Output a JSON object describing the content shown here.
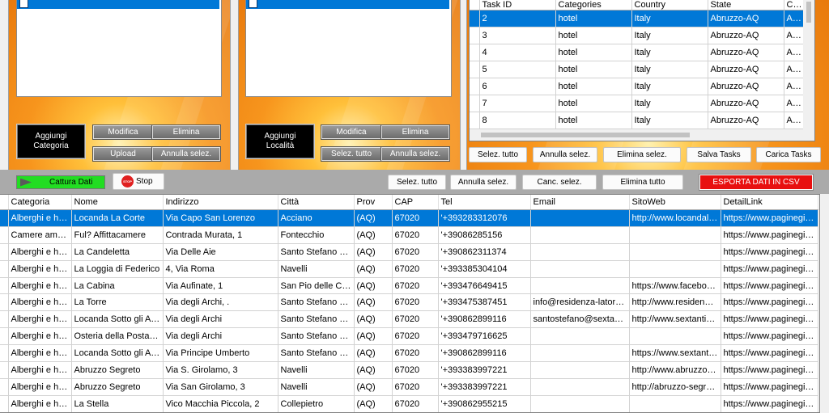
{
  "left_panel_1": {
    "add_button": "Aggiungi Categoria",
    "modify": "Modifica",
    "delete": "Elimina",
    "upload": "Upload",
    "cancel_selection": "Annulla selez."
  },
  "left_panel_2": {
    "add_button": "Aggiungi Località",
    "modify": "Modifica",
    "delete": "Elimina",
    "select_all": "Selez. tutto",
    "cancel_selection": "Annulla selez."
  },
  "tasks": {
    "columns": [
      "Task ID",
      "Categories",
      "Country",
      "State",
      "City"
    ],
    "rows": [
      {
        "id": "2",
        "category": "hotel",
        "country": "Italy",
        "state": "Abruzzo-AQ",
        "city": "Aielli"
      },
      {
        "id": "3",
        "category": "hotel",
        "country": "Italy",
        "state": "Abruzzo-AQ",
        "city": "Albe"
      },
      {
        "id": "4",
        "category": "hotel",
        "country": "Italy",
        "state": "Abruzzo-AQ",
        "city": "Alfe"
      },
      {
        "id": "5",
        "category": "hotel",
        "country": "Italy",
        "state": "Abruzzo-AQ",
        "city": "Antr"
      },
      {
        "id": "6",
        "category": "hotel",
        "country": "Italy",
        "state": "Abruzzo-AQ",
        "city": "Anve"
      },
      {
        "id": "7",
        "category": "hotel",
        "country": "Italy",
        "state": "Abruzzo-AQ",
        "city": "Arag"
      },
      {
        "id": "8",
        "category": "hotel",
        "country": "Italy",
        "state": "Abruzzo-AQ",
        "city": "Aring"
      }
    ],
    "buttons": {
      "select_all": "Selez. tutto",
      "cancel_selection": "Annulla selez.",
      "delete_selected": "Elimina selez.",
      "save_tasks": "Salva Tasks",
      "load_tasks": "Carica Tasks"
    }
  },
  "toolbar": {
    "capture": "Cattura Dati",
    "stop_icon_text": "STOP",
    "stop": "Stop",
    "select_all": "Selez. tutto",
    "cancel_selection": "Annulla selez.",
    "clear_selection": "Canc. selez.",
    "delete_all": "Elimina tutto",
    "export_csv": "ESPORTA DATI IN CSV"
  },
  "results": {
    "columns": [
      "Categoria",
      "Nome",
      "Indirizzo",
      "Città",
      "Prov",
      "CAP",
      "Tel",
      "Email",
      "SitoWeb",
      "DetailLink"
    ],
    "rows": [
      {
        "categoria": "Alberghi e hotel",
        "nome": "Locanda La Corte",
        "indirizzo": "Via Capo San Lorenzo",
        "citta": "Acciano",
        "prov": "(AQ)",
        "cap": "67020",
        "tel": "'+393283312076",
        "email": "",
        "sito": "http://www.locandalacorte.it",
        "link": "https://www.paginegialle.it"
      },
      {
        "categoria": "Camere ammobiliate",
        "nome": "Ful? Affittacamere",
        "indirizzo": "Contrada Murata, 1",
        "citta": "Fontecchio",
        "prov": "(AQ)",
        "cap": "67020",
        "tel": "'+39086285156",
        "email": "",
        "sito": "",
        "link": "https://www.paginegialle.it"
      },
      {
        "categoria": "Alberghi e hotel",
        "nome": "La Candeletta",
        "indirizzo": "Via Delle Aie",
        "citta": "Santo Stefano Di Sessanio",
        "prov": "(AQ)",
        "cap": "67020",
        "tel": "'+390862311374",
        "email": "",
        "sito": "",
        "link": "https://www.paginegialle.it"
      },
      {
        "categoria": "Alberghi e hotel",
        "nome": "La Loggia di Federico",
        "indirizzo": "4, Via Roma",
        "citta": "Navelli",
        "prov": "(AQ)",
        "cap": "67020",
        "tel": "'+393385304104",
        "email": "",
        "sito": "",
        "link": "https://www.paginegialle.it"
      },
      {
        "categoria": "Alberghi e hotel",
        "nome": "La Cabina",
        "indirizzo": "Via Aufinate, 1",
        "citta": "San Pio delle Camere",
        "prov": "(AQ)",
        "cap": "67020",
        "tel": "'+393476649415",
        "email": "",
        "sito": "https://www.facebook.com",
        "link": "https://www.paginegialle.it"
      },
      {
        "categoria": "Alberghi e hotel",
        "nome": "La Torre",
        "indirizzo": "Via degli Archi, .",
        "citta": "Santo Stefano di Sessanio",
        "prov": "(AQ)",
        "cap": "67020",
        "tel": "'+393475387451",
        "email": "info@residenza-latorre.it",
        "sito": "http://www.residenza-latorre.it",
        "link": "https://www.paginegialle.it"
      },
      {
        "categoria": "Alberghi e hotel",
        "nome": "Locanda Sotto gli Archi",
        "indirizzo": "Via degli Archi",
        "citta": "Santo Stefano di Sessanio",
        "prov": "(AQ)",
        "cap": "67020",
        "tel": "'+390862899116",
        "email": "santostefano@sextantio.it",
        "sito": "http://www.sextantio.it",
        "link": "https://www.paginegialle.it"
      },
      {
        "categoria": "Alberghi e hotel",
        "nome": "Osteria della Posta di Sextantio",
        "indirizzo": "Via degli Archi",
        "citta": "Santo Stefano di Sessanio",
        "prov": "(AQ)",
        "cap": "67020",
        "tel": "'+393479716625",
        "email": "",
        "sito": "",
        "link": "https://www.paginegialle.it"
      },
      {
        "categoria": "Alberghi e hotel",
        "nome": "Locanda Sotto gli Archi",
        "indirizzo": "Via Principe Umberto",
        "citta": "Santo Stefano di Sessanio",
        "prov": "(AQ)",
        "cap": "67020",
        "tel": "'+390862899116",
        "email": "",
        "sito": "https://www.sextantio.it",
        "link": "https://www.paginegialle.it"
      },
      {
        "categoria": "Alberghi e hotel",
        "nome": "Abruzzo Segreto",
        "indirizzo": "Via S. Girolamo, 3",
        "citta": "Navelli",
        "prov": "(AQ)",
        "cap": "67020",
        "tel": "'+393383997221",
        "email": "",
        "sito": "http://www.abruzzo-segreto.it",
        "link": "https://www.paginegialle.it"
      },
      {
        "categoria": "Alberghi e hotel",
        "nome": "Abruzzo Segreto",
        "indirizzo": "Via San Girolamo, 3",
        "citta": "Navelli",
        "prov": "(AQ)",
        "cap": "67020",
        "tel": "'+393383997221",
        "email": "",
        "sito": "http://abruzzo-segreto.it",
        "link": "https://www.paginegialle.it"
      },
      {
        "categoria": "Alberghi e hotel",
        "nome": "La Stella",
        "indirizzo": "Vico Macchia Piccola, 2",
        "citta": "Collepietro",
        "prov": "(AQ)",
        "cap": "67020",
        "tel": "'+390862955215",
        "email": "",
        "sito": "",
        "link": "https://www.paginegialle.it"
      }
    ]
  },
  "colors": {
    "selection": "#0078d7",
    "panel_orange": "#f7951d",
    "export_red": "#e81010",
    "capture_green": "#22dd22"
  }
}
